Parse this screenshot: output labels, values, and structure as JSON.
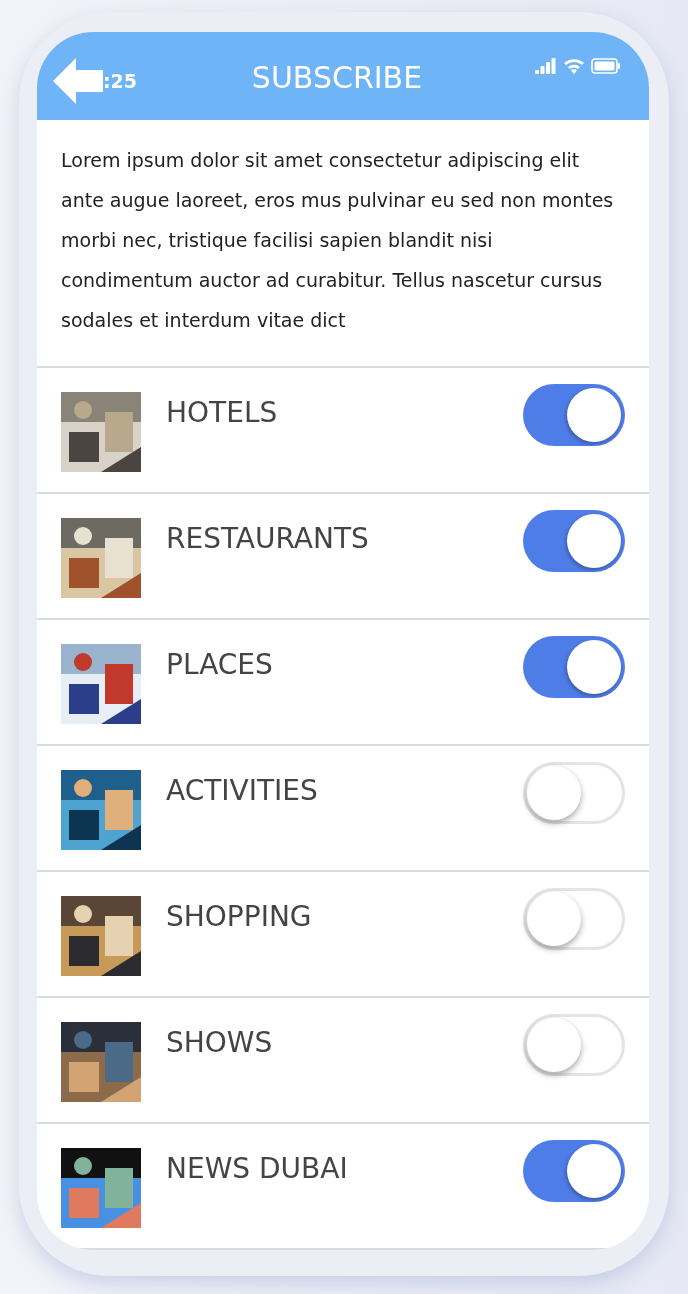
{
  "status_bar": {
    "time": ":25"
  },
  "header": {
    "title": "SUBSCRIBE"
  },
  "description": "Lorem ipsum dolor sit amet consectetur adipiscing elit ante augue laoreet, eros mus pulvinar eu sed non montes morbi nec, tristique facilisi sapien blandit nisi condimentum auctor ad curabitur. Tellus nascetur cursus sodales et interdum vitae dict",
  "categories": [
    {
      "label": "HOTELS",
      "on": true
    },
    {
      "label": "RESTAURANTS",
      "on": true
    },
    {
      "label": "PLACES",
      "on": true
    },
    {
      "label": "ACTIVITIES",
      "on": false
    },
    {
      "label": "SHOPPING",
      "on": false
    },
    {
      "label": "SHOWS",
      "on": false
    },
    {
      "label": "NEWS DUBAI",
      "on": true
    }
  ]
}
